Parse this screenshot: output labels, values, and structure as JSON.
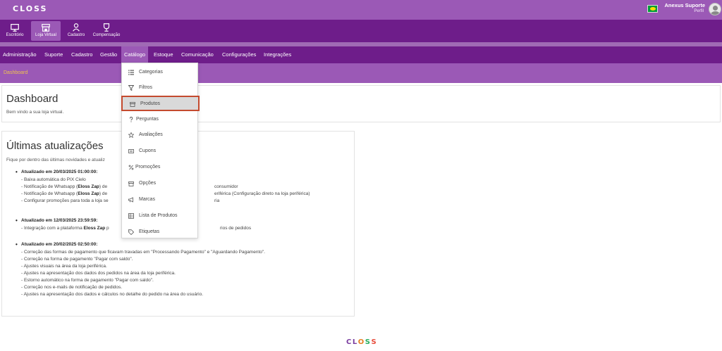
{
  "topbar": {
    "logo": "CLOSS",
    "user_name": "Anexus Suporte",
    "user_role": "Perfil"
  },
  "modules": [
    {
      "label": "Escritório",
      "icon": "monitor-icon"
    },
    {
      "label": "Loja Virtual",
      "icon": "store-icon"
    },
    {
      "label": "Cadastro",
      "icon": "user-icon"
    },
    {
      "label": "Compensação",
      "icon": "trophy-icon"
    }
  ],
  "menu": [
    "Administração",
    "Suporte",
    "Cadastro",
    "Gestão",
    "Catálogo",
    "Estoque",
    "Comunicação",
    "Configurações",
    "Integrações"
  ],
  "breadcrumb": "Dashboard",
  "dashboard": {
    "title": "Dashboard",
    "welcome": "Bem vindo a sua loja virtual."
  },
  "updates": {
    "title": "Últimas atualizações",
    "intro": "Fique por dentro das últimas novidades e atualiz",
    "entries": [
      {
        "head": "Atualizado em 20/03/2025 01:00:00:",
        "lines": [
          "- Baixa automática do PIX Cielo",
          "- Notificação de Whatsapp (",
          "Eloss Zap",
          ") de",
          "consumidor",
          "- Notificação de Whatsapp (",
          "Eloss Zap",
          ") de",
          "eriférica (Configuração direto na loja periférica)",
          "- Configurar promoções para toda a loja se",
          "ria"
        ]
      },
      {
        "head": "Atualizado em 12/03/2025 23:59:59:",
        "lines": [
          "- Integração com a plataforma ",
          "Eloss Zap",
          " p",
          "rios de pedidos"
        ]
      },
      {
        "head": "Atualizado em 20/02/2025 02:50:00:",
        "lines": [
          "- Correção das formas de pagamento que ficavam travadas em \"Processando Pagamento\" e \"Aguardando Pagamento\".",
          "- Correção na forma de pagamento \"Pagar com saldo\".",
          "- Ajustes visuais na área da loja periférica.",
          "- Ajustes na apresentação dos dados dos pedidos na área da loja periférica.",
          "- Estorno automático na forma de pagamento \"Pagar com saldo\".",
          "- Correção nos e-mails de notificação de pedidos.",
          "- Ajustes na apresentação dos dados e cálculos no detalhe do pedido na área do usuário."
        ]
      }
    ]
  },
  "catalog_dropdown": [
    {
      "label": "Categorias",
      "icon": "list-icon"
    },
    {
      "label": "Filtros",
      "icon": "filter-icon"
    },
    {
      "label": "Produtos",
      "icon": "box-icon"
    },
    {
      "label": "Perguntas",
      "icon": "question-icon"
    },
    {
      "label": "Avaliações",
      "icon": "star-icon"
    },
    {
      "label": "Cupons",
      "icon": "ticket-icon"
    },
    {
      "label": "Promoções",
      "icon": "percent-icon"
    },
    {
      "label": "Opções",
      "icon": "options-box-icon"
    },
    {
      "label": "Marcas",
      "icon": "megaphone-icon"
    },
    {
      "label": "Lista de Produtos",
      "icon": "table-icon"
    },
    {
      "label": "Etiquetas",
      "icon": "tag-icon"
    }
  ],
  "footer_logo": "CLOSS",
  "colors": {
    "topbar": "#9b59b6",
    "nav_dark": "#6e1d8a",
    "highlight_border": "#c44a2e",
    "breadcrumb_text": "#f0c44c"
  }
}
